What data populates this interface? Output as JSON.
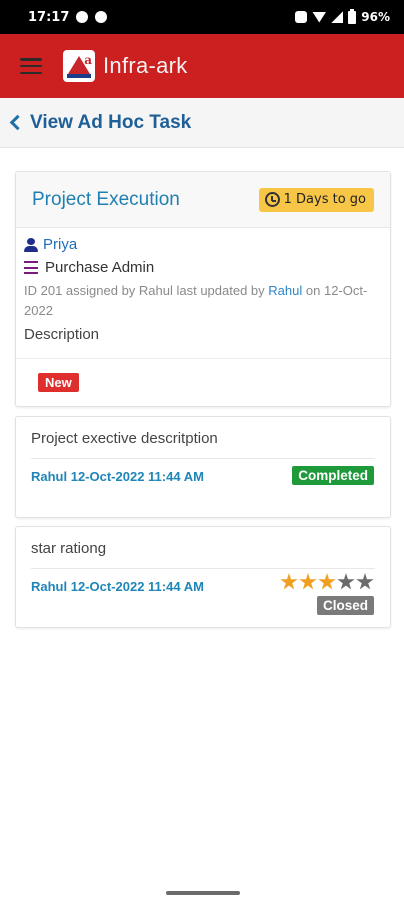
{
  "status_bar": {
    "time": "17:17",
    "battery": "96%"
  },
  "header": {
    "brand": "Infra-ark"
  },
  "sub_header": {
    "title": "View Ad Hoc Task"
  },
  "task": {
    "title": "Project Execution",
    "due_label": "1 Days to go",
    "owner": "Priya",
    "role": "Purchase Admin",
    "meta_prefix": "ID 201 assigned by Rahul last updated by",
    "meta_updated_by": "Rahul",
    "meta_suffix": "on 12-Oct-2022",
    "description_label": "Description",
    "status_badge": "New"
  },
  "comments": [
    {
      "text": "Project exective descritption",
      "meta": "Rahul 12-Oct-2022 11:44 AM",
      "status": "Completed",
      "status_color": "#1f9a3a"
    },
    {
      "text": "star rationg",
      "meta": "Rahul 12-Oct-2022 11:44 AM",
      "status": "Closed",
      "status_color": "#7a7a7a",
      "rating": 3,
      "rating_max": 5
    }
  ],
  "colors": {
    "header_bg": "#cc1f1f",
    "link": "#1f6fbb",
    "accent_blue": "#1f7fb0",
    "due_badge": "#f8c646",
    "new_badge": "#df2e2e"
  }
}
